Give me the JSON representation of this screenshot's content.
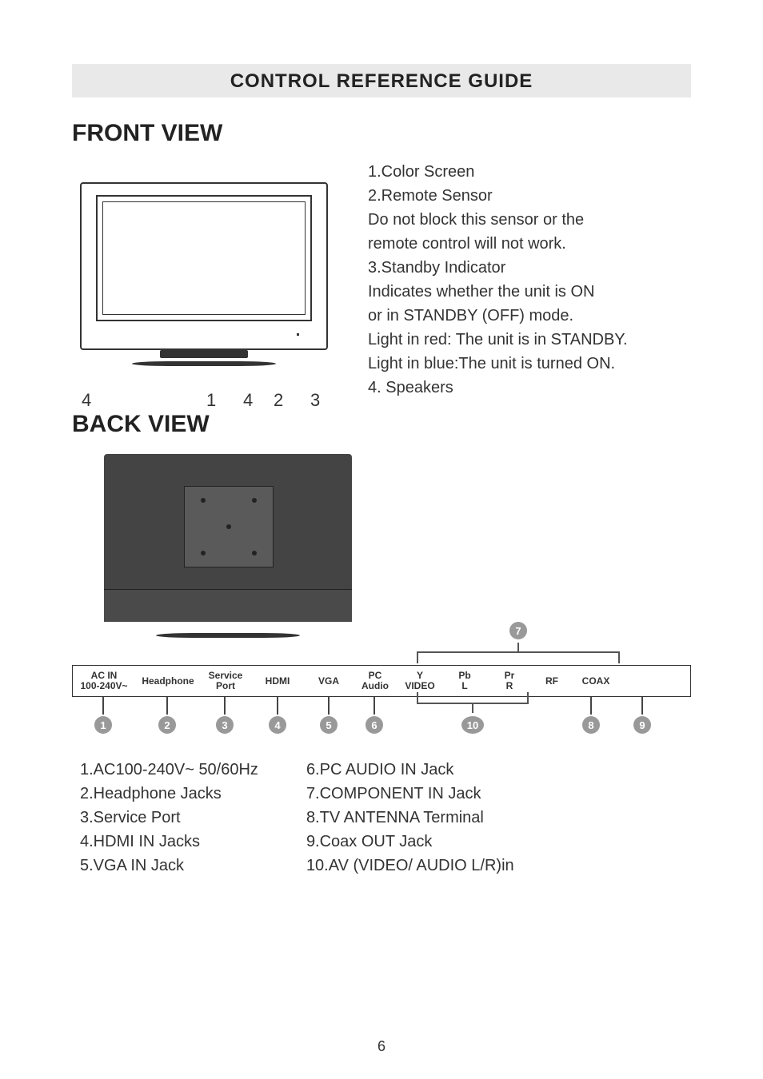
{
  "title": "CONTROL REFERENCE GUIDE",
  "front": {
    "heading": "FRONT VIEW",
    "callouts": [
      "4",
      "1",
      "4",
      "2",
      "3"
    ],
    "lines": [
      "1.Color Screen",
      "2.Remote Sensor",
      "Do not block this sensor or the",
      "remote control will not work.",
      "3.Standby Indicator",
      "Indicates whether the unit is ON",
      "or in STANDBY (OFF) mode.",
      "Light in red: The unit is in STANDBY.",
      "Light in blue:The unit is turned ON.",
      "4. Speakers"
    ]
  },
  "back": {
    "heading": "BACK VIEW",
    "connectors": [
      {
        "line1": "AC IN",
        "line2": "100-240V~",
        "num": "1"
      },
      {
        "line1": "Headphone",
        "line2": "",
        "num": "2"
      },
      {
        "line1": "Service",
        "line2": "Port",
        "num": "3"
      },
      {
        "line1": "HDMI",
        "line2": "",
        "num": "4"
      },
      {
        "line1": "VGA",
        "line2": "",
        "num": "5"
      },
      {
        "line1": "PC",
        "line2": "Audio",
        "num": "6"
      },
      {
        "line1": "Y",
        "line2": "VIDEO",
        "num": ""
      },
      {
        "line1": "Pb",
        "line2": "L",
        "num": ""
      },
      {
        "line1": "Pr",
        "line2": "R",
        "num": ""
      },
      {
        "line1": "RF",
        "line2": "",
        "num": "8"
      },
      {
        "line1": "COAX",
        "line2": "",
        "num": "9"
      }
    ],
    "bracket_num": "7",
    "ten_num": "10",
    "list_left": [
      "1.AC100-240V~ 50/60Hz",
      "2.Headphone Jacks",
      "3.Service Port",
      "4.HDMI IN Jacks",
      "5.VGA IN Jack"
    ],
    "list_right": [
      "6.PC AUDIO IN Jack",
      "7.COMPONENT IN Jack",
      "8.TV ANTENNA Terminal",
      "9.Coax OUT Jack",
      "10.AV (VIDEO/  AUDIO L/R)in"
    ]
  },
  "page_number": "6"
}
